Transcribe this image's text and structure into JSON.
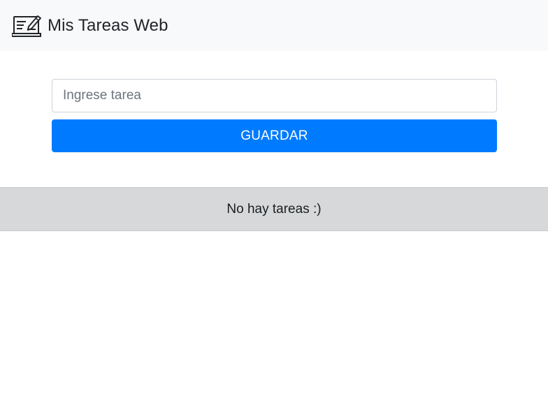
{
  "navbar": {
    "logo_icon": "notebook-pen-icon",
    "title": "Mis Tareas Web"
  },
  "form": {
    "input_placeholder": "Ingrese tarea",
    "input_value": "",
    "save_label": "GUARDAR"
  },
  "tasks": {
    "empty_message": "No hay tareas :)"
  },
  "colors": {
    "navbar_bg": "#f8f9fa",
    "button_primary": "#007bff",
    "empty_bar_bg": "#d6d8d9"
  }
}
